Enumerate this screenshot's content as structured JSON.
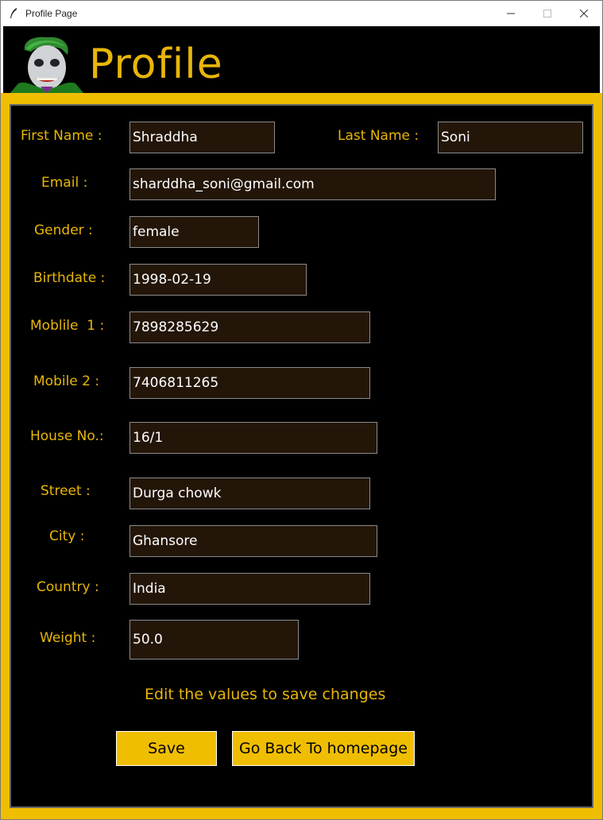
{
  "window": {
    "title": "Profile Page"
  },
  "header": {
    "title": "Profile",
    "avatar_icon": "joker-avatar-icon"
  },
  "form": {
    "fields": [
      {
        "key": "first_name",
        "label": "First Name :",
        "value": "Shraddha"
      },
      {
        "key": "last_name",
        "label": "Last Name :",
        "value": "Soni"
      },
      {
        "key": "email",
        "label": "Email :",
        "value": "sharddha_soni@gmail.com"
      },
      {
        "key": "gender",
        "label": "Gender :",
        "value": "female"
      },
      {
        "key": "birthdate",
        "label": "Birthdate :",
        "value": "1998-02-19"
      },
      {
        "key": "mobile1",
        "label": "Moblile  1 :",
        "value": "7898285629"
      },
      {
        "key": "mobile2",
        "label": "Mobile 2 :",
        "value": "7406811265"
      },
      {
        "key": "house_no",
        "label": "House No.:",
        "value": "16/1"
      },
      {
        "key": "street",
        "label": "Street :",
        "value": "Durga chowk"
      },
      {
        "key": "city",
        "label": "City :",
        "value": "Ghansore"
      },
      {
        "key": "country",
        "label": "Country :",
        "value": "India"
      },
      {
        "key": "weight",
        "label": "Weight :",
        "value": "50.0"
      }
    ],
    "hint": "Edit the values to save changes",
    "save_label": "Save",
    "back_label": "Go Back To homepage"
  },
  "colors": {
    "accent_gold": "#f0be00",
    "label_gold": "#e8b60a",
    "field_bg": "#231609",
    "panel_bg": "#000000"
  }
}
